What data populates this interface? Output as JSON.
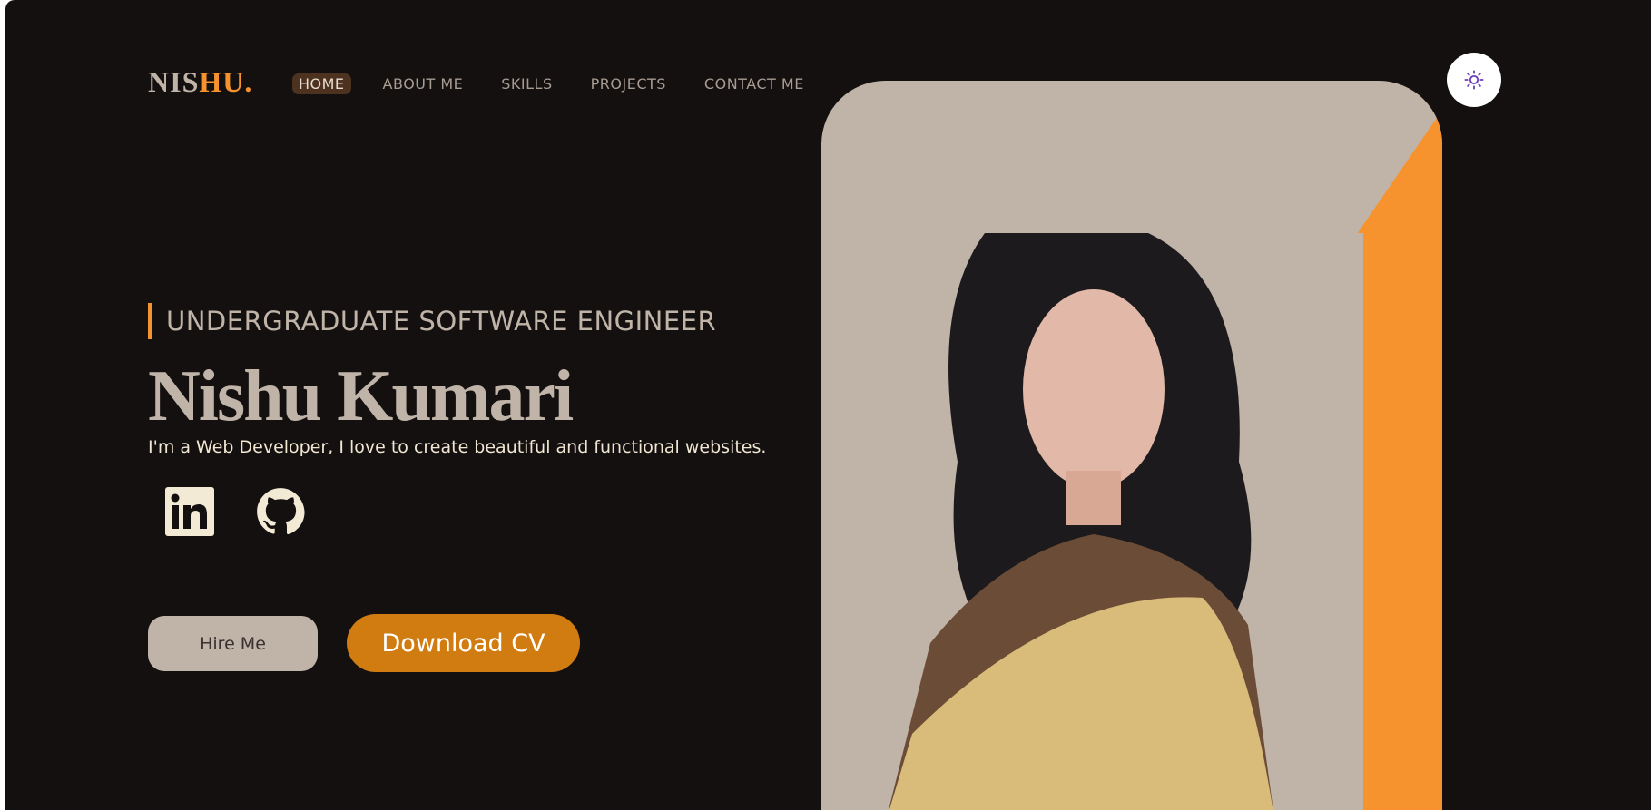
{
  "logo": {
    "part1": "NIS",
    "part2": "HU."
  },
  "nav": {
    "items": [
      {
        "label": "HOME",
        "active": true
      },
      {
        "label": "ABOUT ME",
        "active": false
      },
      {
        "label": "SKILLS",
        "active": false
      },
      {
        "label": "PROJECTS",
        "active": false
      },
      {
        "label": "CONTACT ME",
        "active": false
      }
    ]
  },
  "theme_toggle": {
    "icon": "sun-icon"
  },
  "hero": {
    "subtitle": "UNDERGRADUATE SOFTWARE ENGINEER",
    "name": "Nishu Kumari",
    "tagline": "I'm a Web Developer, I love to create beautiful and functional websites.",
    "social": [
      {
        "icon": "linkedin-icon"
      },
      {
        "icon": "github-icon"
      }
    ],
    "hire_label": "Hire Me",
    "download_label": "Download CV"
  },
  "colors": {
    "background": "#141010",
    "accent": "#f7932f",
    "text": "#c0b4a8",
    "button_orange": "#d17c10"
  }
}
